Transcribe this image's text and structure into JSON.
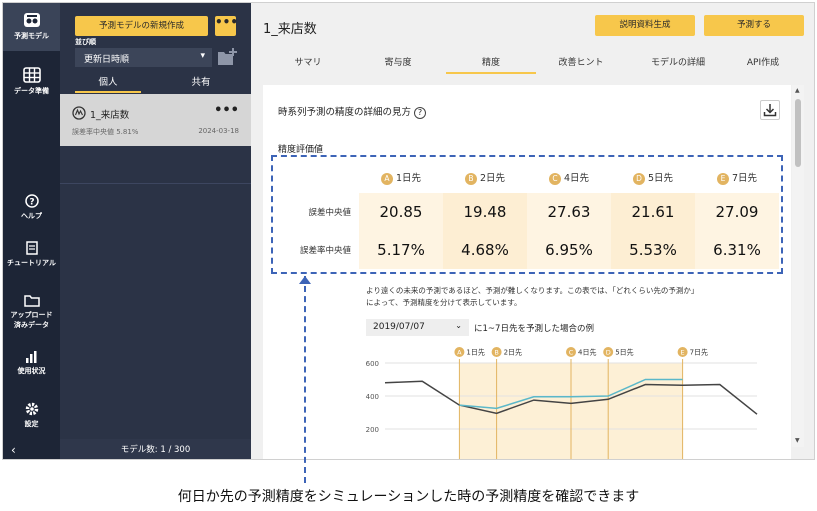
{
  "rail": {
    "items": [
      {
        "label": "予測モデル",
        "icon": "model-icon"
      },
      {
        "label": "データ準備",
        "icon": "table-icon"
      },
      {
        "label": "ヘルプ",
        "icon": "help-icon"
      },
      {
        "label": "チュートリアル",
        "icon": "document-icon"
      },
      {
        "label": "アップロード済みデータ",
        "label_l1": "アップロード",
        "label_l2": "済みデータ",
        "icon": "folder-icon"
      },
      {
        "label": "使用状況",
        "icon": "bar-chart-icon"
      },
      {
        "label": "設定",
        "icon": "gear-icon"
      }
    ],
    "collapse": "‹"
  },
  "panel": {
    "new_model_label": "予測モデルの新規作成",
    "more_label": "•••",
    "sort_label": "並び順",
    "sort_value": "更新日時順",
    "segments": [
      "個人",
      "共有"
    ],
    "model_card": {
      "name": "1_来店数",
      "meta": "誤差率中央値 5.81%",
      "date": "2024-03-18",
      "more": "•••"
    },
    "footer": "モデル数: 1 / 300"
  },
  "main": {
    "title": "1_来店数",
    "explain_label": "説明資料生成",
    "predict_label": "予測する",
    "tabs": [
      "サマリ",
      "寄与度",
      "精度",
      "改善ヒント",
      "モデルの詳細",
      "API作成"
    ],
    "active_tab": "精度",
    "heading": "時系列予測の精度の詳細の見方",
    "help": "?",
    "subheading": "精度評価値",
    "columns": [
      {
        "marker": "A",
        "label": "1日先"
      },
      {
        "marker": "B",
        "label": "2日先"
      },
      {
        "marker": "C",
        "label": "4日先"
      },
      {
        "marker": "D",
        "label": "5日先"
      },
      {
        "marker": "E",
        "label": "7日先"
      }
    ],
    "rows": [
      {
        "label": "誤差中央値",
        "values": [
          "20.85",
          "19.48",
          "27.63",
          "21.61",
          "27.09"
        ]
      },
      {
        "label": "誤差率中央値",
        "values": [
          "5.17%",
          "4.68%",
          "6.95%",
          "5.53%",
          "6.31%"
        ]
      }
    ],
    "note_line1": "より遠くの未来の予測であるほど、予測が難しくなります。この表では、「どれくらい先の予測か」",
    "note_line2": "によって、予測精度を分けて表示しています。",
    "date_value": "2019/07/07",
    "date_caption": "に1~7日先を予測した場合の例"
  },
  "chart_data": {
    "type": "line",
    "x": [
      0,
      1,
      2,
      3,
      4,
      5,
      6,
      7,
      8,
      9,
      10
    ],
    "ylim": [
      0,
      600
    ],
    "yticks": [
      "0",
      "200",
      "400",
      "600"
    ],
    "markers": [
      {
        "letter": "A",
        "label": "1日先",
        "x": 2
      },
      {
        "letter": "B",
        "label": "2日先",
        "x": 3
      },
      {
        "letter": "C",
        "label": "4日先",
        "x": 5
      },
      {
        "letter": "D",
        "label": "5日先",
        "x": 6
      },
      {
        "letter": "E",
        "label": "7日先",
        "x": 8
      }
    ],
    "highlight": [
      2,
      8
    ],
    "series": [
      {
        "values": [
          480,
          490,
          345,
          295,
          375,
          355,
          380,
          470,
          465,
          470,
          290
        ],
        "color": "#444444"
      },
      {
        "values": [
          null,
          null,
          345,
          325,
          395,
          395,
          400,
          500,
          500,
          null,
          null
        ],
        "color": "#5bb8c9"
      }
    ]
  },
  "caption": "何日か先の予測精度をシミュレーションした時の予測精度を確認できます",
  "colors": {
    "rail": "#1d2536",
    "panel": "#2b3346",
    "accent": "#f7c74b",
    "dash": "#3d64b7",
    "cell_light": "#fef4e2",
    "cell_dark": "#fdeed3"
  }
}
